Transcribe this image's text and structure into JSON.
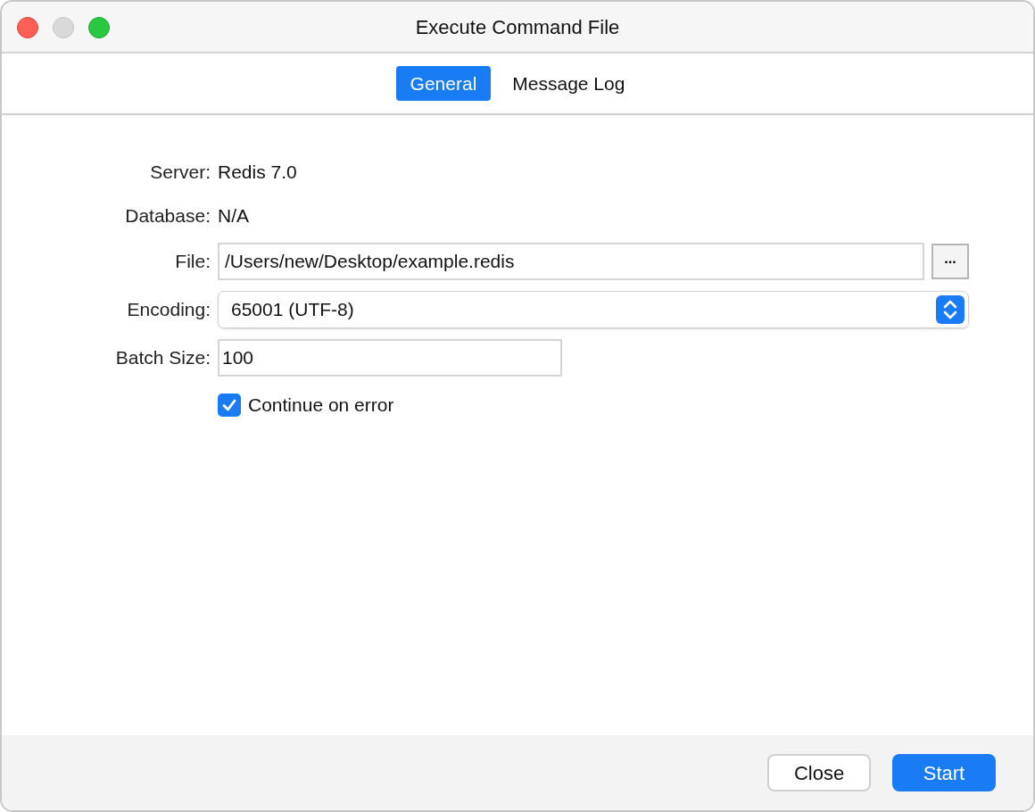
{
  "window": {
    "title": "Execute Command File"
  },
  "tabs": [
    {
      "label": "General",
      "selected": true
    },
    {
      "label": "Message Log",
      "selected": false
    }
  ],
  "form": [
    {
      "kind": "info",
      "label": "Server:",
      "value": "Redis 7.0"
    },
    {
      "kind": "info",
      "label": "Database:",
      "value": "N/A"
    },
    {
      "kind": "file",
      "label": "File:",
      "value": "/Users/new/Desktop/example.redis",
      "button": "..."
    },
    {
      "kind": "select",
      "label": "Encoding:",
      "value": "65001 (UTF-8)"
    },
    {
      "kind": "text",
      "label": "Batch Size:",
      "value": "100"
    },
    {
      "kind": "checkbox",
      "label": "Continue on error",
      "checked": true
    }
  ],
  "buttons": [
    {
      "label": "Close",
      "primary": false
    },
    {
      "label": "Start",
      "primary": true
    }
  ]
}
